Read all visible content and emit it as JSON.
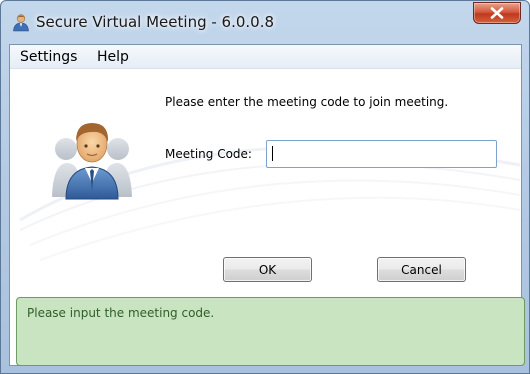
{
  "window": {
    "title": "Secure Virtual Meeting - 6.0.0.8",
    "app_icon": "meeting-user-icon",
    "close_icon": "close-icon"
  },
  "menu": {
    "items": [
      {
        "label": "Settings"
      },
      {
        "label": "Help"
      }
    ]
  },
  "main": {
    "prompt": "Please enter the meeting code to join meeting.",
    "code_label": "Meeting Code:",
    "code_value": "",
    "avatar_icon": "user-avatar-icon"
  },
  "buttons": {
    "ok_label": "OK",
    "cancel_label": "Cancel"
  },
  "status": {
    "message": "Please input the meeting code."
  },
  "colors": {
    "status_bg": "#c9e4c0",
    "status_border": "#6e9a63",
    "status_text": "#2f5f2a",
    "close_button": "#c0391c",
    "input_border": "#7da2ce"
  }
}
